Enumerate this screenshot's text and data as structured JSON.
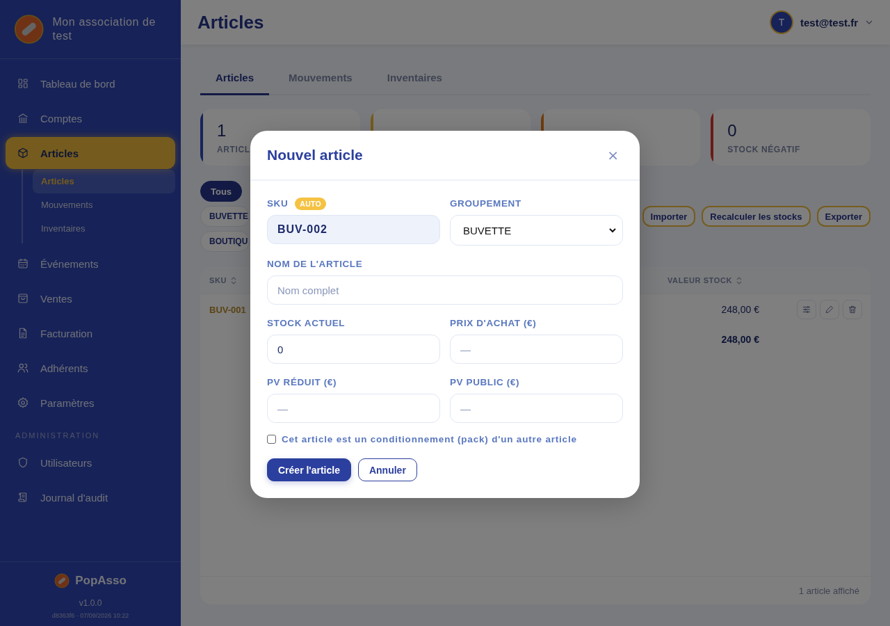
{
  "sidebar": {
    "org_name": "Mon association de test",
    "items": [
      {
        "label": "Tableau de bord",
        "selected": false
      },
      {
        "label": "Comptes",
        "selected": false
      },
      {
        "label": "Articles",
        "selected": true,
        "children": [
          {
            "label": "Articles",
            "selected": true
          },
          {
            "label": "Mouvements",
            "selected": false
          },
          {
            "label": "Inventaires",
            "selected": false
          }
        ]
      },
      {
        "label": "Événements",
        "selected": false
      },
      {
        "label": "Ventes",
        "selected": false
      },
      {
        "label": "Facturation",
        "selected": false
      },
      {
        "label": "Adhérents",
        "selected": false
      },
      {
        "label": "Paramètres",
        "selected": false
      }
    ],
    "section_title": "ADMINISTRATION",
    "admin_items": [
      {
        "label": "Utilisateurs",
        "selected": false
      },
      {
        "label": "Journal d'audit",
        "selected": false
      }
    ],
    "footer": {
      "brand": "PopAsso",
      "version": "v1.0.0",
      "build": "d8363f6 · 07/09/2026 10:22"
    }
  },
  "header": {
    "title": "Articles",
    "user": {
      "initial": "T",
      "email": "test@test.fr"
    }
  },
  "tabs": [
    {
      "label": "Articles",
      "selected": true
    },
    {
      "label": "Mouvements",
      "selected": false
    },
    {
      "label": "Inventaires",
      "selected": false
    }
  ],
  "stats": [
    {
      "value": "1",
      "label": "ARTICL",
      "color": "#17235a"
    },
    {
      "color": "#755c1e"
    },
    {
      "color": "#703d0d"
    },
    {
      "value": "0",
      "label": "STOCK NÉGATIF",
      "color": "#6c1a16"
    }
  ],
  "filters": {
    "chips": [
      {
        "label": "Tous",
        "selected": true
      }
    ],
    "groups": [
      {
        "label": "BUVETTE",
        "selected": false
      },
      {
        "label": "BOUTIQU",
        "selected": false
      }
    ],
    "actions": [
      "Importer",
      "Recalculer les stocks",
      "Exporter"
    ]
  },
  "table": {
    "columns": [
      {
        "label": "SKU"
      },
      {
        "label": "VALEUR STOCK"
      }
    ],
    "rows": [
      {
        "sku": "BUV-001",
        "value": "248,00 €"
      }
    ],
    "total": "248,00 €",
    "footer": "1 article affiché"
  },
  "modal": {
    "title": "Nouvel article",
    "close": "×",
    "fields": [
      {
        "label": "SKU",
        "badge": "AUTO",
        "kind": "auto",
        "value": "BUV-002"
      },
      {
        "label": "GROUPEMENT",
        "kind": "select",
        "value": "BUVETTE"
      },
      {
        "label": "NOM DE L'ARTICLE",
        "kind": "wide",
        "placeholder": "Nom complet"
      },
      {
        "label": "STOCK ACTUEL",
        "kind": "text",
        "value": "0"
      },
      {
        "label": "PRIX D'ACHAT (€)",
        "kind": "text",
        "placeholder": "—"
      },
      {
        "label": "PV RÉDUIT (€)",
        "kind": "text",
        "placeholder": "—"
      },
      {
        "label": "PV PUBLIC (€)",
        "kind": "text",
        "placeholder": "—"
      }
    ],
    "pack_checkbox": {
      "label": "Cet article est un conditionnement (pack) d'un autre article",
      "checked": false
    },
    "buttons": [
      {
        "label": "Créer l'article",
        "kind": "primary"
      },
      {
        "label": "Annuler",
        "kind": "secondary"
      }
    ]
  }
}
